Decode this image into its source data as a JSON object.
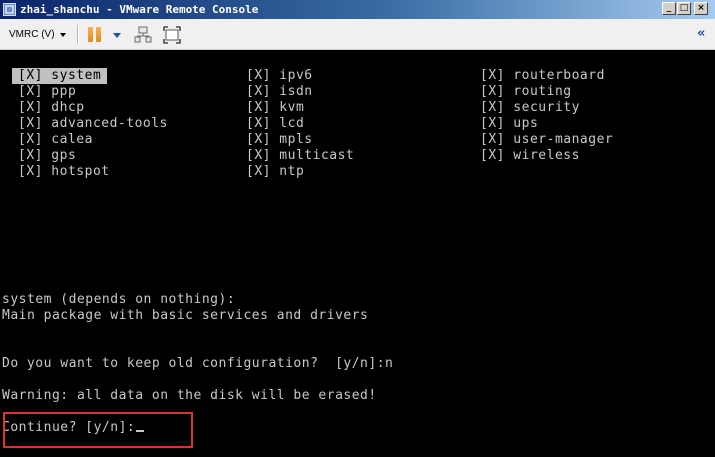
{
  "window": {
    "title": "zhai_shanchu - VMware Remote Console",
    "minimize_glyph": "_",
    "maximize_glyph": "□",
    "close_glyph": "×",
    "icon": "vmware-app-icon"
  },
  "toolbar": {
    "vmrc_menu_label": "VMRC (V)",
    "pause_icon": "pause-icon",
    "devices_icon": "removable-devices-icon",
    "fullscreen_icon": "fullscreen-icon",
    "collapse_glyph": "«"
  },
  "console": {
    "packages": [
      [
        "[X] system",
        "[X] ppp",
        "[X] dhcp",
        "[X] advanced-tools",
        "[X] calea",
        "[X] gps",
        "[X] hotspot"
      ],
      [
        "[X] ipv6",
        "[X] isdn",
        "[X] kvm",
        "[X] lcd",
        "[X] mpls",
        "[X] multicast",
        "[X] ntp"
      ],
      [
        "[X] routerboard",
        "[X] routing",
        "[X] security",
        "[X] ups",
        "[X] user-manager",
        "[X] wireless"
      ]
    ],
    "selected_package": "[X] system",
    "description_header": "system (depends on nothing):",
    "description_body": "Main package with basic services and drivers",
    "keep_config_prompt": "Do you want to keep old configuration?  [y/n]:n",
    "warning": "Warning: all data on the disk will be erased!",
    "continue_prompt": "Continue? [y/n]:"
  },
  "colors": {
    "console_bg": "#000000",
    "console_text": "#c8c8c8",
    "selection_bg": "#c0c0c0",
    "highlight_border": "#e03030",
    "titlebar_start": "#0a246a",
    "titlebar_end": "#a6caf0"
  }
}
